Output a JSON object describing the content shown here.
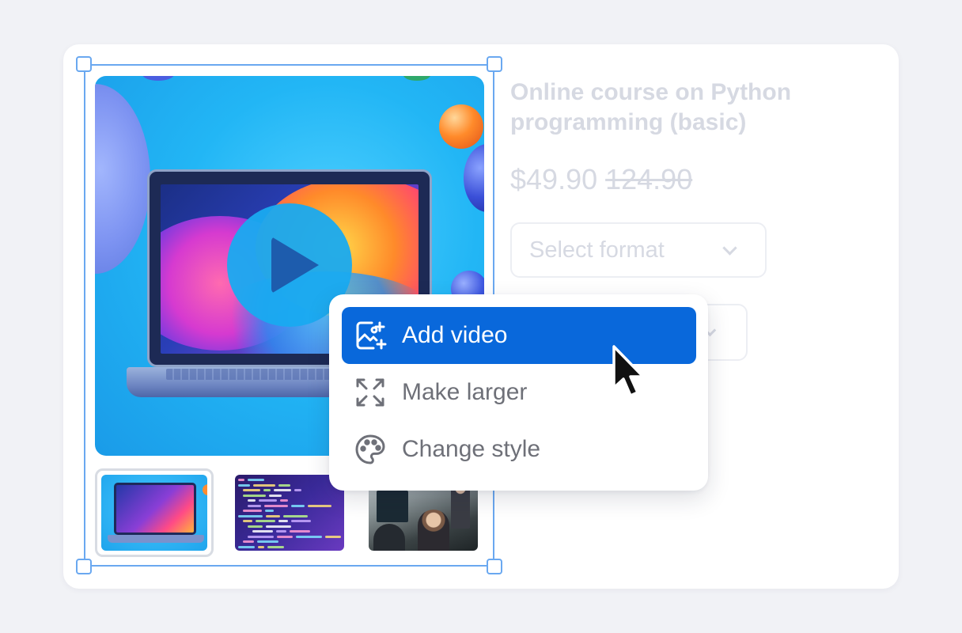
{
  "product": {
    "title": "Online course on Python programming (basic)",
    "price_current": "$49.90",
    "price_original": "124.90",
    "format_select": {
      "selected": "Select format"
    }
  },
  "context_menu": {
    "items": [
      {
        "label": "Add video",
        "icon": "image-plus-icon",
        "active": true
      },
      {
        "label": "Make larger",
        "icon": "expand-icon",
        "active": false
      },
      {
        "label": "Change style",
        "icon": "palette-icon",
        "active": false
      }
    ]
  },
  "colors": {
    "accent": "#0968db",
    "selection": "#6aa8f0",
    "menu_text": "#6e7078",
    "faded_text": "#d6d9e2"
  }
}
